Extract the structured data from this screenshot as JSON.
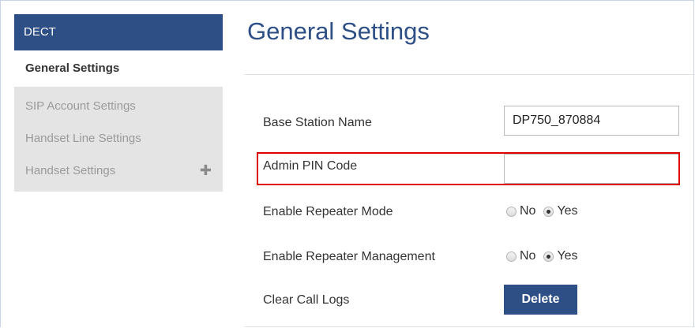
{
  "sidebar": {
    "header": "DECT",
    "active_item": "General Settings",
    "items": [
      {
        "label": "SIP Account Settings"
      },
      {
        "label": "Handset Line Settings"
      },
      {
        "label": "Handset Settings",
        "expand_icon": "plus-icon"
      }
    ]
  },
  "main": {
    "title": "General Settings",
    "base_station_name": {
      "label": "Base Station Name",
      "value": "DP750_870884"
    },
    "admin_pin": {
      "label": "Admin PIN Code",
      "value": ""
    },
    "repeater_mode": {
      "label": "Enable Repeater Mode",
      "no_label": "No",
      "yes_label": "Yes",
      "selected": "Yes"
    },
    "repeater_management": {
      "label": "Enable Repeater Management",
      "no_label": "No",
      "yes_label": "Yes",
      "selected": "Yes"
    },
    "clear_call_logs": {
      "label": "Clear Call Logs",
      "button_label": "Delete"
    }
  },
  "colors": {
    "accent": "#2d4f86",
    "highlight_border": "#e00000"
  }
}
